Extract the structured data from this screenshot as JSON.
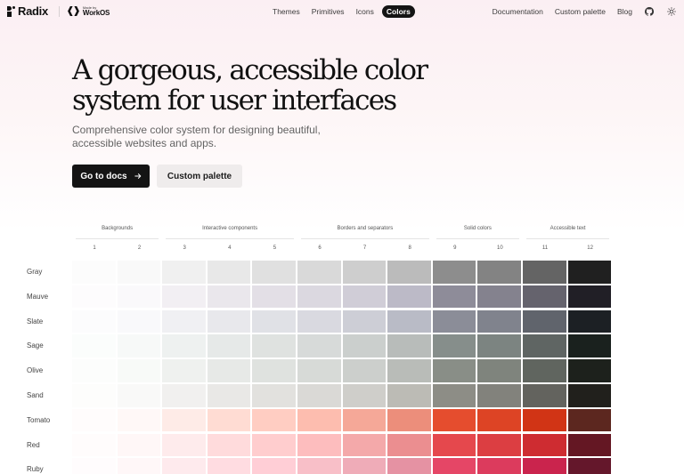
{
  "header": {
    "brand": "Radix",
    "partner_small": "Made by",
    "partner_name": "WorkOS",
    "nav_center": [
      "Themes",
      "Primitives",
      "Icons",
      "Colors"
    ],
    "nav_active": "Colors",
    "nav_right": [
      "Documentation",
      "Custom palette",
      "Blog"
    ],
    "icons": [
      "github-icon",
      "sun-icon"
    ]
  },
  "hero": {
    "title_line1": "A gorgeous, accessible color",
    "title_line2": "system for user interfaces",
    "subtitle_line1": "Comprehensive color system for designing beautiful,",
    "subtitle_line2": "accessible websites and apps.",
    "primary_button": "Go to docs",
    "secondary_button": "Custom palette"
  },
  "palette": {
    "groups": [
      "Backgrounds",
      "Interactive components",
      "Borders and separators",
      "Solid colors",
      "Accessible text"
    ],
    "columns": [
      "1",
      "2",
      "3",
      "4",
      "5",
      "6",
      "7",
      "8",
      "9",
      "10",
      "11",
      "12"
    ],
    "rows": [
      {
        "name": "Gray",
        "colors": [
          "#fcfcfc",
          "#f9f9f9",
          "#f0f0f0",
          "#e8e8e8",
          "#e0e0e0",
          "#d9d9d9",
          "#cecece",
          "#bbbbbb",
          "#8d8d8d",
          "#838383",
          "#646464",
          "#202020"
        ]
      },
      {
        "name": "Mauve",
        "colors": [
          "#fdfcfd",
          "#faf9fb",
          "#f2eff3",
          "#eae7ec",
          "#e3dfe6",
          "#dbd8e0",
          "#d0cdd7",
          "#bcbac7",
          "#8e8c99",
          "#84828e",
          "#65636d",
          "#211f26"
        ]
      },
      {
        "name": "Slate",
        "colors": [
          "#fcfcfd",
          "#f9f9fb",
          "#f0f0f3",
          "#e8e8ec",
          "#e0e1e6",
          "#d9d9e0",
          "#cdced6",
          "#b9bbc6",
          "#8b8d98",
          "#80838d",
          "#60646c",
          "#1c2024"
        ]
      },
      {
        "name": "Sage",
        "colors": [
          "#fbfdfc",
          "#f7f9f8",
          "#eef1f0",
          "#e6e9e8",
          "#dfe2e0",
          "#d7dad9",
          "#cbcfcd",
          "#b8bcba",
          "#868e8b",
          "#7c8481",
          "#5f6563",
          "#1a211e"
        ]
      },
      {
        "name": "Olive",
        "colors": [
          "#fcfdfc",
          "#f8faf8",
          "#eff1ef",
          "#e7e9e7",
          "#dfe2df",
          "#d7dad7",
          "#cccfcc",
          "#b9bcb8",
          "#898e87",
          "#7f847d",
          "#60655f",
          "#1d211c"
        ]
      },
      {
        "name": "Sand",
        "colors": [
          "#fdfdfc",
          "#f9f9f8",
          "#f1f0ef",
          "#e9e8e6",
          "#e2e1de",
          "#dad9d6",
          "#cfceca",
          "#bcbbb5",
          "#8d8d86",
          "#82827c",
          "#63635e",
          "#21201c"
        ]
      },
      {
        "name": "Tomato",
        "colors": [
          "#fffcfc",
          "#fff8f7",
          "#feebe7",
          "#ffdcd3",
          "#ffcdc2",
          "#fdbdaf",
          "#f5a898",
          "#ec8e7b",
          "#e54d2e",
          "#dd4425",
          "#d13415",
          "#5c271f"
        ]
      },
      {
        "name": "Red",
        "colors": [
          "#fffcfc",
          "#fff7f7",
          "#feebec",
          "#ffdbdc",
          "#ffcdce",
          "#fdbdbe",
          "#f4a9aa",
          "#eb8e90",
          "#e5484d",
          "#dc3e42",
          "#ce2c31",
          "#641723"
        ]
      },
      {
        "name": "Ruby",
        "colors": [
          "#fffcfd",
          "#fff7f8",
          "#feeaed",
          "#ffdce1",
          "#ffced6",
          "#f8bfc8",
          "#efacb8",
          "#e592a3",
          "#e54666",
          "#dc3b5d",
          "#ca244d",
          "#64172b"
        ]
      }
    ]
  }
}
